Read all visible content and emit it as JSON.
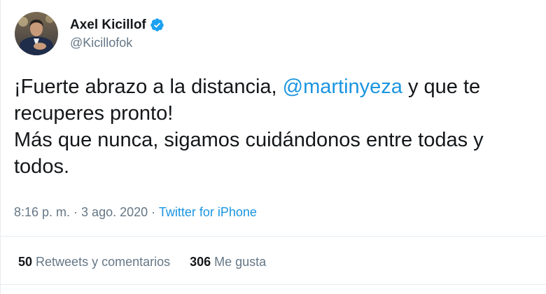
{
  "user": {
    "display_name": "Axel Kicillof",
    "handle": "@Kicillofok",
    "verified": true,
    "avatar_icon": "profile-photo"
  },
  "tweet": {
    "line1_before": "¡Fuerte abrazo a la distancia, ",
    "line1_mention": "@martinyeza",
    "line1_after": " y que te",
    "line2": "recuperes pronto!",
    "line3": "Más que nunca, sigamos cuidándonos entre todas y",
    "line4": "todos."
  },
  "meta": {
    "time": "8:16 p. m.",
    "sep1": " · ",
    "date": "3 ago. 2020",
    "sep2": " · ",
    "source": "Twitter for iPhone"
  },
  "stats": {
    "retweets_count": "50",
    "retweets_label": "Retweets y comentarios",
    "likes_count": "306",
    "likes_label": "Me gusta"
  },
  "colors": {
    "link": "#1b95e0",
    "text": "#14171a",
    "muted": "#657786",
    "divider": "#e6ecf0"
  }
}
